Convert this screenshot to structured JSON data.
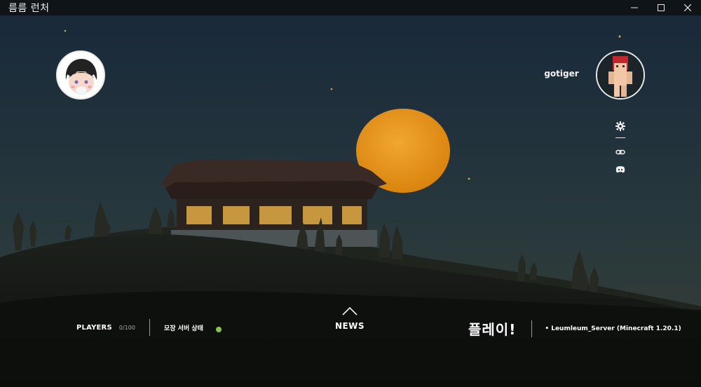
{
  "window": {
    "title": "름름 런처",
    "controls": [
      {
        "name": "minimize"
      },
      {
        "name": "maximize"
      },
      {
        "name": "close"
      }
    ]
  },
  "profile": {
    "username": "gotiger"
  },
  "sidebar": {
    "icons": [
      "gear-icon",
      "link-icon",
      "discord-icon"
    ]
  },
  "status": {
    "players_label": "PLAYERS",
    "players_count": "0/100",
    "server_status_label": "모장 서버 상태",
    "server_status_color": "#8bc34a"
  },
  "news": {
    "label": "NEWS"
  },
  "play": {
    "label": "플레이!",
    "server": "• Leumleum_Server (Minecraft 1.20.1)"
  },
  "colors": {
    "sky_top": "#1a2a36",
    "sky_bottom": "#2d3d3f",
    "moon": "#e7961d",
    "titlebar": "#0f1418"
  }
}
